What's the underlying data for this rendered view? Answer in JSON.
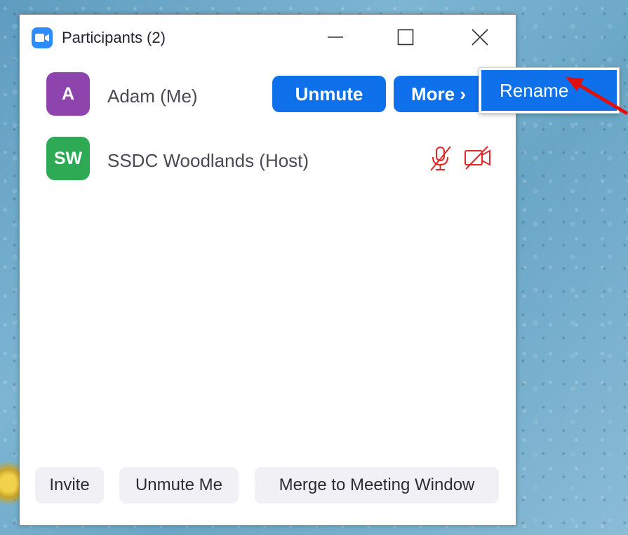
{
  "window": {
    "title": "Participants (2)"
  },
  "participants": [
    {
      "initials": "A",
      "name": "Adam (Me)",
      "avatar_color": "#8e44ad",
      "unmute_label": "Unmute",
      "more_label": "More ›"
    },
    {
      "initials": "SW",
      "name": "SSDC Woodlands (Host)",
      "avatar_color": "#2eaa55",
      "mic_icon": "mic-off-icon",
      "video_icon": "video-off-icon"
    }
  ],
  "context_menu": {
    "items": [
      {
        "label": "Rename"
      }
    ]
  },
  "footer": {
    "invite_label": "Invite",
    "unmute_me_label": "Unmute Me",
    "merge_label": "Merge to Meeting Window"
  },
  "colors": {
    "accent": "#0e71eb",
    "muted_icon": "#e02828",
    "annotation_arrow": "#e01010"
  }
}
